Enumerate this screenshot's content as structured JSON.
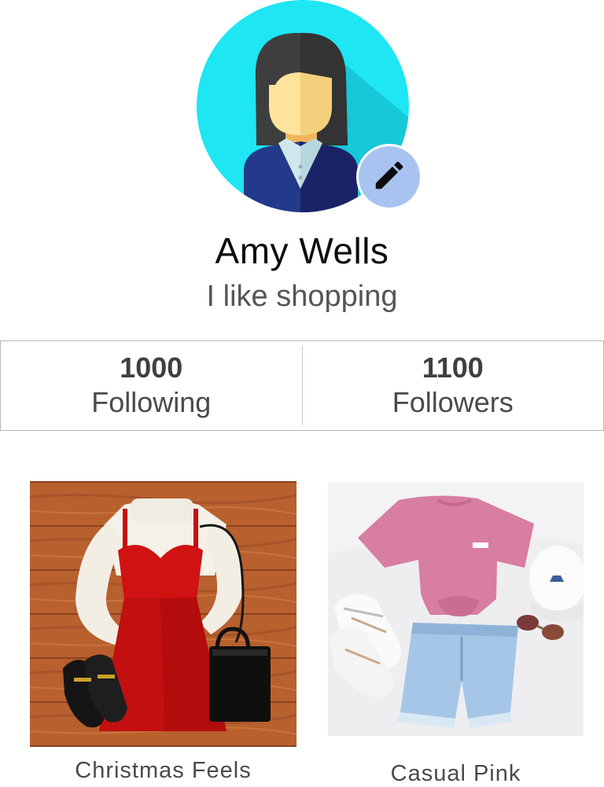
{
  "profile": {
    "name": "Amy Wells",
    "bio": "I like shopping",
    "avatar_icon": "woman-avatar-icon",
    "edit_icon": "pencil-icon",
    "colors": {
      "avatar_bg": "#1ee6f2",
      "edit_button_bg": "#a9c3f1"
    }
  },
  "stats": {
    "following": {
      "count": "1000",
      "label": "Following"
    },
    "followers": {
      "count": "1100",
      "label": "Followers"
    }
  },
  "outfits": [
    {
      "title": "Christmas Feels"
    },
    {
      "title": "Casual Pink"
    }
  ]
}
